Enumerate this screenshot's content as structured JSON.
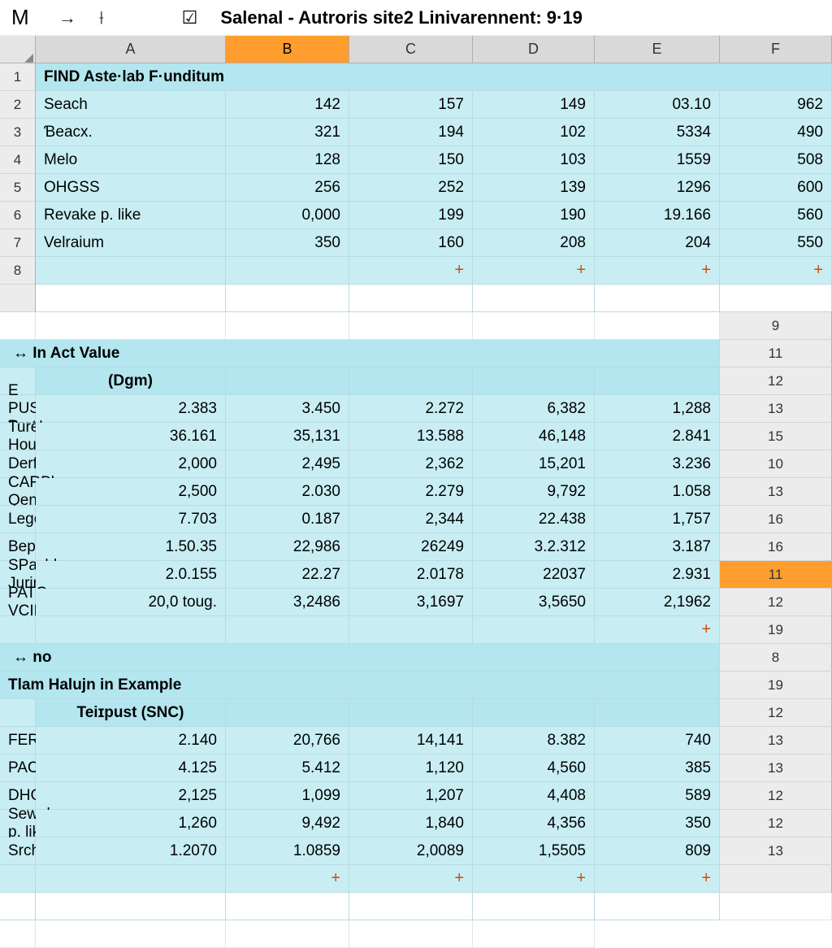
{
  "titlebar": {
    "m": "M",
    "arrow": "→",
    "pin": "⟊",
    "docicon": "☑",
    "title": "Salenal - Autroris site2 Linivarennent: 9·19"
  },
  "columns": [
    "A",
    "B",
    "C",
    "D",
    "E",
    "F"
  ],
  "rows": [
    {
      "n": "1",
      "type": "hdr",
      "a": "FIND Aste·lab F·unditum"
    },
    {
      "n": "2",
      "a": "Seach",
      "b": "142",
      "c": "157",
      "d": "149",
      "e": "03.10",
      "f": "962"
    },
    {
      "n": "3",
      "a": "Ɓeacx.",
      "b": "321",
      "c": "194",
      "d": "102",
      "e": "5334",
      "f": "490"
    },
    {
      "n": "4",
      "a": "Melo",
      "b": "128",
      "c": "150",
      "d": "103",
      "e": "1559",
      "f": "508"
    },
    {
      "n": "5",
      "a": "OHGSS",
      "b": "256",
      "c": "252",
      "d": "139",
      "e": "1296",
      "f": "600"
    },
    {
      "n": "6",
      "a": "Revake p. like",
      "b": "0,000",
      "c": "199",
      "d": "190",
      "e": "19.166",
      "f": "560"
    },
    {
      "n": "7",
      "a": "Velraium",
      "b": "350",
      "c": "160",
      "d": "208",
      "e": "204",
      "f": "550"
    },
    {
      "n": "8",
      "type": "plusrow"
    },
    {
      "type": "gap"
    },
    {
      "n": "9",
      "type": "sub",
      "a": "↔ In Act Value"
    },
    {
      "n": "11",
      "type": "subc",
      "b": "(Dgm)"
    },
    {
      "n": "12",
      "a": "E PUS Prot",
      "b": "2.383",
      "c": "3.450",
      "d": "2.272",
      "e": "6,382",
      "f": "1,288"
    },
    {
      "n": "13",
      "a": "Turek Houe",
      "b": "36.161",
      "c": "35,131",
      "d": "13.588",
      "e": "46,148",
      "f": "2.841"
    },
    {
      "n": "15",
      "a": "Derful",
      "b": "2,000",
      "c": "2,495",
      "d": "2,362",
      "e": "15,201",
      "f": "3.236"
    },
    {
      "n": "10",
      "a": "CARBlc Qenfiorts",
      "b": "2,500",
      "c": "2.030",
      "d": "2.279",
      "e": "9,792",
      "f": "1.058"
    },
    {
      "n": "13",
      "a": "Legonalts",
      "b": "7.703",
      "c": "0.187",
      "d": "2,344",
      "e": "22.438",
      "f": "1,757"
    },
    {
      "n": "16",
      "a": "Bepentent",
      "b": "1.50.35",
      "c": "22,986",
      "d": "26249",
      "e": "3.2.312",
      "f": "3.187"
    },
    {
      "n": "16",
      "a": "SPachle Jurira",
      "b": "2.0.155",
      "c": "22.27",
      "d": "2.0178",
      "e": "22037",
      "f": "2.931"
    },
    {
      "n": "11",
      "sel": true,
      "a": "PATC VCIDEA",
      "b": "20,0 toug.",
      "c": "3,2486",
      "d": "3,1697",
      "e": "3,5650",
      "f": "2,1962"
    },
    {
      "n": "12",
      "type": "plusrow2"
    },
    {
      "n": "19",
      "type": "sub",
      "a": "↔ no"
    },
    {
      "n": "8",
      "type": "hdr",
      "a": "Tlam Halujn in Example"
    },
    {
      "n": "19",
      "type": "subc",
      "b": "Teiɪpust (SNC)"
    },
    {
      "n": "12",
      "a": "FERS",
      "b": "2.140",
      "c": "20,766",
      "d": "14,141",
      "e": "8.382",
      "f": "740"
    },
    {
      "n": "13",
      "a": "PACTE",
      "b": "4.125",
      "c": "5.412",
      "d": "1,120",
      "e": "4,560",
      "f": "385"
    },
    {
      "n": "13",
      "a": "DHGSS",
      "b": "2,125",
      "c": "1,099",
      "d": "1,207",
      "e": "4,408",
      "f": "589"
    },
    {
      "n": "12",
      "a": "Sewake p. like",
      "b": "1,260",
      "c": "9,492",
      "d": "1,840",
      "e": "4,356",
      "f": "350"
    },
    {
      "n": "12",
      "a": "Srchhotol",
      "b": "1.2070",
      "c": "1.0859",
      "d": "2,0089",
      "e": "1,5505",
      "f": "809"
    },
    {
      "n": "13",
      "type": "plusrow"
    },
    {
      "type": "gap"
    }
  ],
  "plus": "+"
}
